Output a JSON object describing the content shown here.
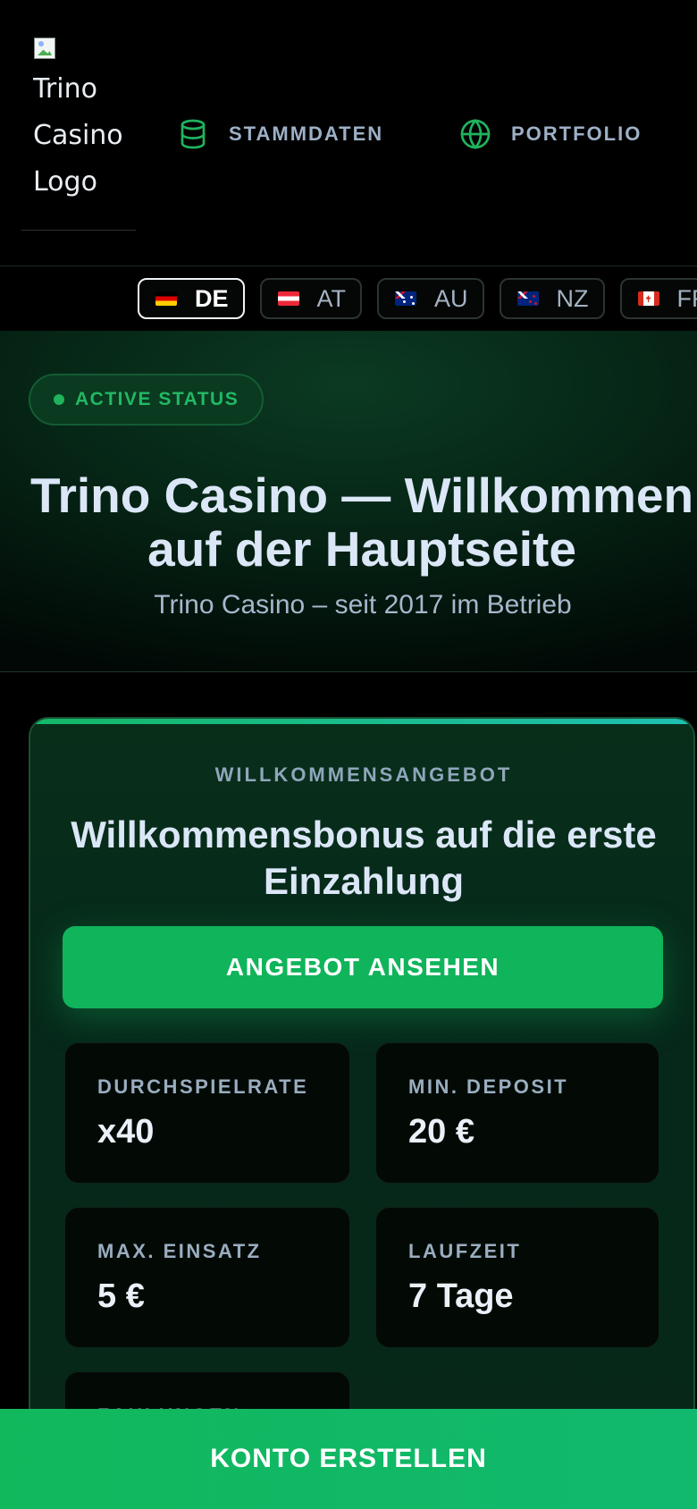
{
  "header": {
    "logo_alt": "Trino Casino Logo",
    "nav": [
      {
        "label": "STAMMDATEN",
        "icon": "database-icon"
      },
      {
        "label": "PORTFOLIO",
        "icon": "globe-icon"
      }
    ]
  },
  "countries": [
    {
      "code": "DE",
      "flag": "flag-de",
      "active": true
    },
    {
      "code": "AT",
      "flag": "flag-at",
      "active": false
    },
    {
      "code": "AU",
      "flag": "flag-au",
      "active": false
    },
    {
      "code": "NZ",
      "flag": "flag-nz",
      "active": false
    },
    {
      "code": "FR",
      "flag": "flag-ca",
      "active": false
    }
  ],
  "hero": {
    "status": "ACTIVE STATUS",
    "title": "Trino Casino — Willkommen auf der Hauptseite",
    "subtitle": "Trino Casino – seit 2017 im Betrieb"
  },
  "bonus": {
    "kicker": "WILLKOMMENSANGEBOT",
    "title": "Willkommensbonus auf die erste Einzahlung",
    "cta": "ANGEBOT ANSEHEN",
    "stats": [
      {
        "label": "DURCHSPIELRATE",
        "value": "x40"
      },
      {
        "label": "MIN. DEPOSIT",
        "value": "20 €"
      },
      {
        "label": "MAX. EINSATZ",
        "value": "5 €"
      },
      {
        "label": "LAUFZEIT",
        "value": "7 Tage"
      },
      {
        "label": "ZAHLUNGEN",
        "value": ""
      }
    ]
  },
  "sticky_cta": "KONTO ERSTELLEN",
  "colors": {
    "accent_green": "#10b45b",
    "status_green": "#22b865",
    "background": "#000000"
  }
}
